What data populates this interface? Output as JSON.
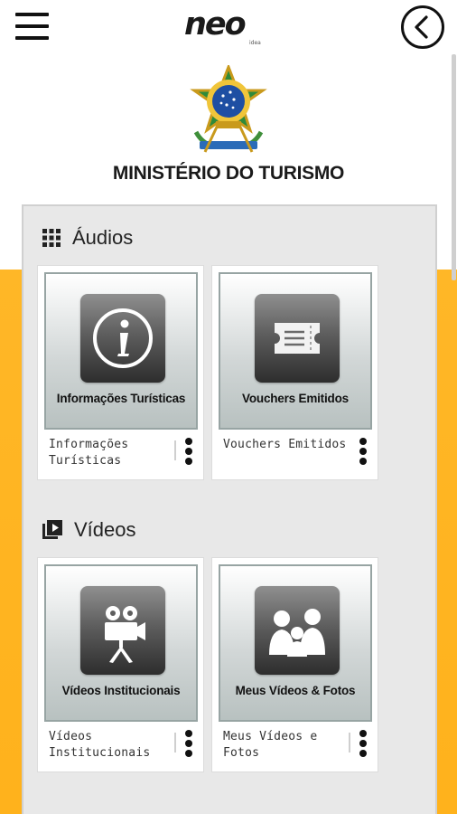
{
  "header": {
    "logo_text": "neo",
    "logo_sub": "idea",
    "menu_icon": "hamburger-menu-icon",
    "back_icon": "chevron-left-circle-icon"
  },
  "ministry": {
    "title": "MINISTÉRIO DO TURISMO",
    "emblem": "brazil-coat-of-arms"
  },
  "sections": [
    {
      "title": "Áudios",
      "icon": "grid-apps-icon",
      "cards": [
        {
          "thumb_title": "Informações Turísticas",
          "caption": "Informações Turísticas",
          "icon": "info-icon"
        },
        {
          "thumb_title": "Vouchers Emitidos",
          "caption": "Vouchers Emitidos",
          "icon": "ticket-icon"
        }
      ]
    },
    {
      "title": "Vídeos",
      "icon": "video-library-icon",
      "cards": [
        {
          "thumb_title": "Vídeos Institucionais",
          "caption": "Vídeos Institucionais",
          "icon": "film-camera-icon"
        },
        {
          "thumb_title": "Meus Vídeos & Fotos",
          "caption": "Meus Vídeos e Fotos",
          "icon": "family-people-icon"
        }
      ]
    }
  ],
  "colors": {
    "accent_orange": "#ffb727",
    "panel_bg": "#e8e8e8",
    "thumb_border": "#97a4a3"
  }
}
